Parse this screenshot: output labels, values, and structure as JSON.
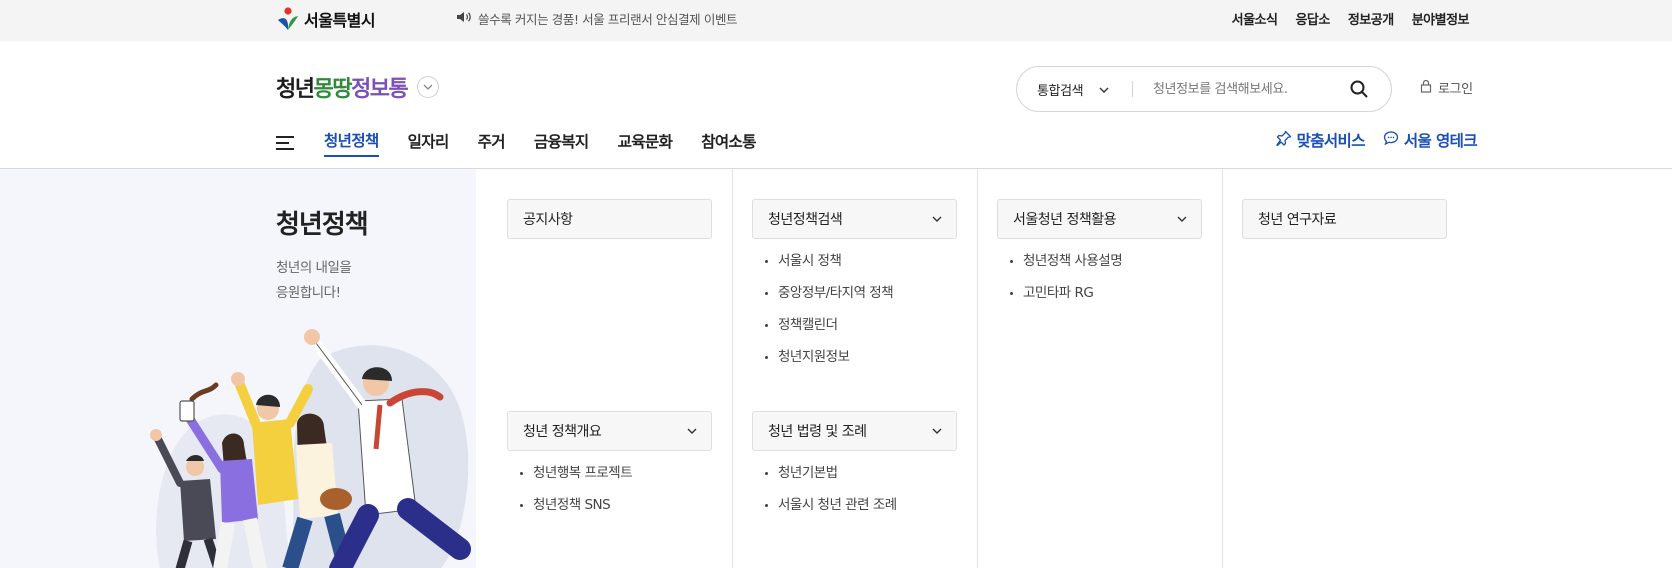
{
  "topbar": {
    "seoul_logo": "서울특별시",
    "notice_icon": "speaker-icon",
    "notice_text": "쓸수록 커지는 경품! 서울 프리랜서 안심결제 이벤트",
    "links": [
      "서울소식",
      "응답소",
      "정보공개",
      "분야별정보"
    ]
  },
  "header": {
    "brand": {
      "part1": "청년",
      "part2": "몽땅",
      "part3": "정보통"
    },
    "search": {
      "scope": "통합검색",
      "placeholder": "청년정보를 검색해보세요."
    },
    "login": "로그인",
    "gnb": [
      "청년정책",
      "일자리",
      "주거",
      "금융복지",
      "교육문화",
      "참여소통"
    ],
    "active_gnb": "청년정책",
    "quick": {
      "custom_service": "맞춤서비스",
      "talk": "서울 영테크"
    }
  },
  "mega": {
    "title": "청년정책",
    "desc_line1": "청년의 내일을",
    "desc_line2": "응원합니다!",
    "columns": {
      "notice": {
        "title": "공지사항"
      },
      "overview": {
        "title": "청년 정책개요",
        "items": [
          "청년행복 프로젝트",
          "청년정책 SNS"
        ]
      },
      "policy_search": {
        "title": "청년정책검색",
        "items": [
          "서울시 정책",
          "중앙정부/타지역 정책",
          "정책캘린더",
          "청년지원정보"
        ]
      },
      "law": {
        "title": "청년 법령 및 조례",
        "items": [
          "청년기본법",
          "서울시 청년 관련 조례"
        ]
      },
      "utilize": {
        "title": "서울청년 정책활용",
        "items": [
          "청년정책 사용설명",
          "고민타파 RG"
        ]
      },
      "research": {
        "title": "청년 연구자료"
      }
    }
  },
  "colors": {
    "accent": "#1a4fb5",
    "panel_bg": "#f4f6fb",
    "topbar_bg": "#f4f4f4"
  }
}
